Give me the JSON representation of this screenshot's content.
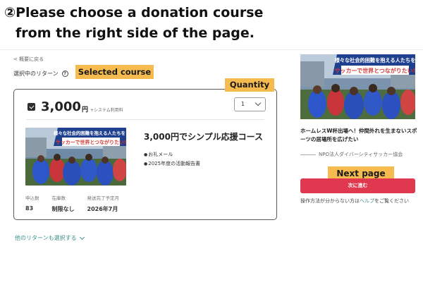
{
  "step": {
    "title_line1": "②Please choose a donation course",
    "title_line2": "from the right side of the page."
  },
  "nav": {
    "back_link": "< 概要に戻る"
  },
  "section": {
    "label": "選択中のリターン",
    "help_icon": "question-circle-icon"
  },
  "callouts": {
    "selected": "Selected course",
    "quantity": "Quantity",
    "next": "Next page"
  },
  "course": {
    "price": "3,000",
    "price_unit": "円",
    "price_note": "+システム利用料",
    "quantity_value": "1",
    "title": "3,000円でシンプル応援コース",
    "items": [
      "お礼メール",
      "2025年度の活動報告書"
    ],
    "stats": [
      {
        "label": "申込数",
        "value": "83"
      },
      {
        "label": "在庫数",
        "value": "制限なし"
      },
      {
        "label": "発送完了予定月",
        "value": "2026年7月"
      }
    ],
    "image_caption_1": "様々な社会的困難を抱える人たちを",
    "image_caption_2": "サッカーで世界とつながりたい!"
  },
  "more_link": "他のリターンも選択する",
  "side": {
    "title": "ホームレスW杯出場へ！仲間外れを生まないスポーツの居場所を広げたい",
    "org": "NPO法人ダイバーシティサッカー協会",
    "next_button": "次に進む",
    "help_prefix": "操作方法が分からない方は",
    "help_link": "ヘルプ",
    "help_suffix": "をご覧ください"
  },
  "colors": {
    "accent": "#f5bb4f",
    "next_button": "#e0384f",
    "link": "#3b8f8a"
  }
}
